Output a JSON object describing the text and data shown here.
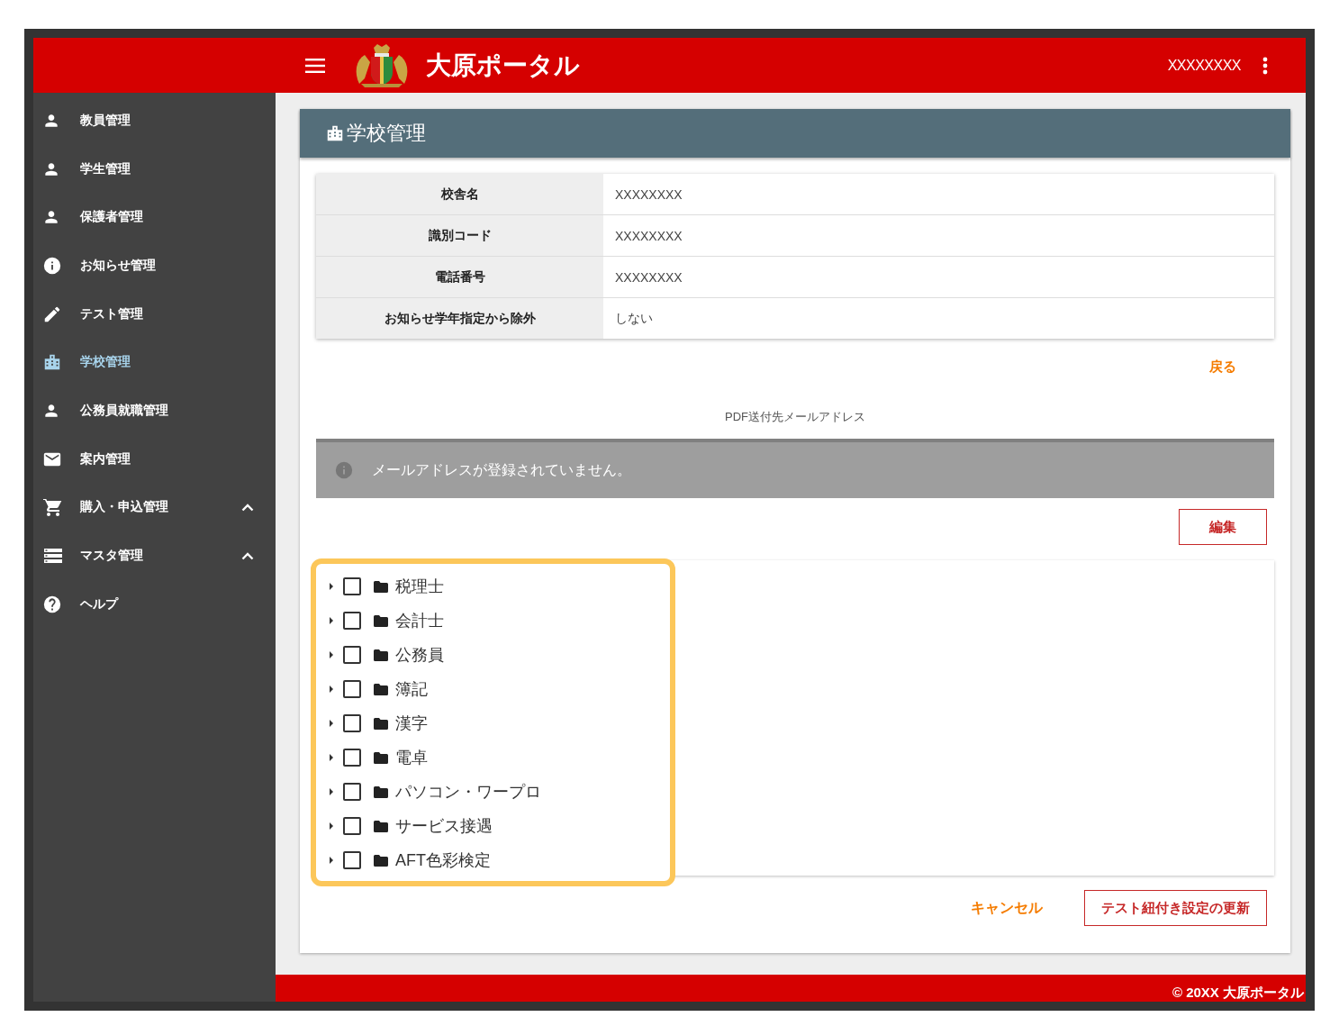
{
  "header": {
    "title": "大原ポータル",
    "user": "XXXXXXXX"
  },
  "sidebar": {
    "items": [
      {
        "label": "教員管理",
        "kind": "person",
        "selected": false,
        "submenu": false
      },
      {
        "label": "学生管理",
        "kind": "person",
        "selected": false,
        "submenu": false
      },
      {
        "label": "保護者管理",
        "kind": "person",
        "selected": false,
        "submenu": false
      },
      {
        "label": "お知らせ管理",
        "kind": "info",
        "selected": false,
        "submenu": false
      },
      {
        "label": "テスト管理",
        "kind": "pencil",
        "selected": false,
        "submenu": false
      },
      {
        "label": "学校管理",
        "kind": "building",
        "selected": true,
        "submenu": false
      },
      {
        "label": "公務員就職管理",
        "kind": "person",
        "selected": false,
        "submenu": false
      },
      {
        "label": "案内管理",
        "kind": "mail",
        "selected": false,
        "submenu": false
      },
      {
        "label": "購入・申込管理",
        "kind": "cart",
        "selected": false,
        "submenu": true
      },
      {
        "label": "マスタ管理",
        "kind": "list",
        "selected": false,
        "submenu": true
      },
      {
        "label": "ヘルプ",
        "kind": "help",
        "selected": false,
        "submenu": false
      }
    ]
  },
  "page": {
    "title": "学校管理",
    "details": [
      {
        "label": "校舎名",
        "value": "XXXXXXXX"
      },
      {
        "label": "識別コード",
        "value": "XXXXXXXX"
      },
      {
        "label": "電話番号",
        "value": "XXXXXXXX"
      },
      {
        "label": "お知らせ学年指定から除外",
        "value": "しない"
      }
    ],
    "back_link": "戻る",
    "email_section_label": "PDF送付先メールアドレス",
    "email_notice": "メールアドレスが登録されていません。",
    "edit_button": "編集",
    "tree": [
      {
        "label": "税理士",
        "checked": false,
        "expanded": false
      },
      {
        "label": "会計士",
        "checked": false,
        "expanded": false
      },
      {
        "label": "公務員",
        "checked": false,
        "expanded": false
      },
      {
        "label": "簿記",
        "checked": false,
        "expanded": false
      },
      {
        "label": "漢字",
        "checked": false,
        "expanded": false
      },
      {
        "label": "電卓",
        "checked": false,
        "expanded": false
      },
      {
        "label": "パソコン・ワープロ",
        "checked": false,
        "expanded": false
      },
      {
        "label": "サービス接遇",
        "checked": false,
        "expanded": false
      },
      {
        "label": "AFT色彩検定",
        "checked": false,
        "expanded": false
      }
    ],
    "cancel_button": "キャンセル",
    "update_button": "テスト紐付き設定の更新"
  },
  "footer": {
    "copyright": "© 20XX 大原ポータル"
  }
}
